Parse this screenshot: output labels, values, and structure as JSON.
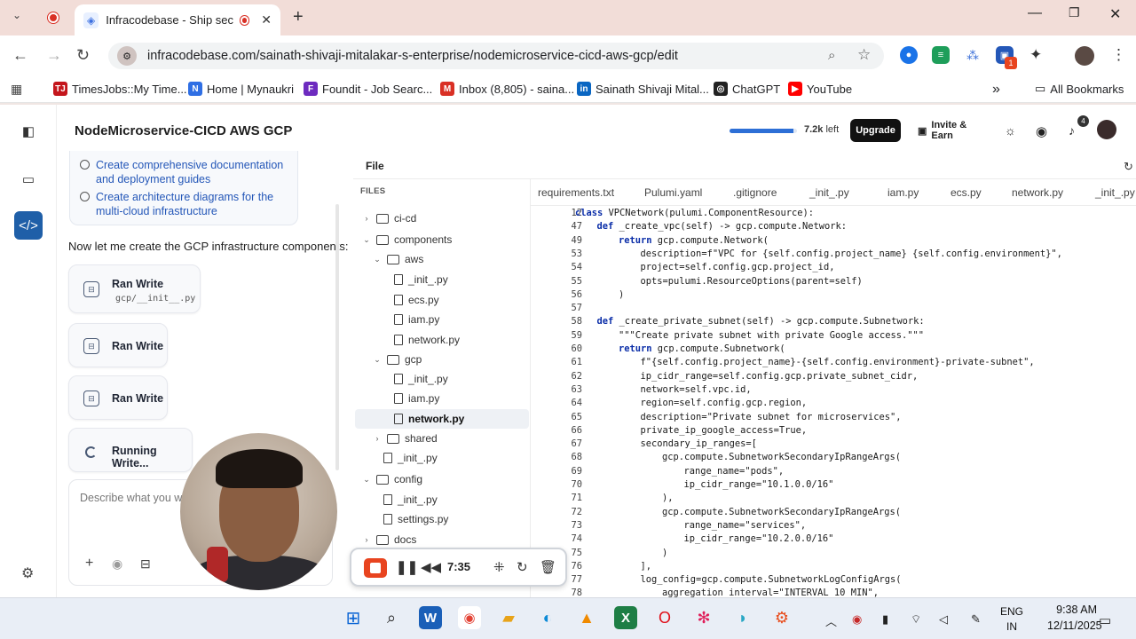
{
  "browser": {
    "tab_title": "Infracodebase - Ship secure",
    "url": "infracodebase.com/sainath-shivaji-mitalakar-s-enterprise/nodemicroservice-cicd-aws-gcp/edit",
    "extension_badge": "1",
    "bookmarks": [
      {
        "label": "TimesJobs::My Time...",
        "icon": "TJ",
        "color": "#c4161c"
      },
      {
        "label": "Home | Mynaukri",
        "icon": "N",
        "color": "#2f6fe4"
      },
      {
        "label": "Foundit - Job Searc...",
        "icon": "F",
        "color": "#6d2bbf"
      },
      {
        "label": "Inbox (8,805) - saina...",
        "icon": "M",
        "color": "#d93025"
      },
      {
        "label": "Sainath Shivaji Mital...",
        "icon": "in",
        "color": "#0a66c2"
      },
      {
        "label": "ChatGPT",
        "icon": "◎",
        "color": "#222222"
      },
      {
        "label": "YouTube",
        "icon": "▶",
        "color": "#ff0000"
      }
    ],
    "all_bookmarks": "All Bookmarks"
  },
  "app": {
    "title": "NodeMicroservice-CICD AWS GCP",
    "credits": "7.2k",
    "credits_suffix": "left",
    "credits_fraction": 0.95,
    "upgrade": "Upgrade",
    "invite": "Invite & Earn",
    "notif_count": "4"
  },
  "chat": {
    "todos": [
      "Create comprehensive documentation and deployment guides",
      "Create architecture diagrams for the multi-cloud infrastructure"
    ],
    "message": "Now let me create the GCP infrastructure components:",
    "tools": [
      {
        "label": "Ran Write",
        "sub": "gcp/__init__.py"
      },
      {
        "label": "Ran Write",
        "sub": ""
      },
      {
        "label": "Ran Write",
        "sub": ""
      },
      {
        "label": "Running Write...",
        "sub": ""
      }
    ],
    "placeholder": "Describe what you want"
  },
  "files": {
    "menu": "File",
    "header": "FILES",
    "tree": [
      {
        "label": "ci-cd",
        "type": "folder",
        "open": false,
        "depth": 0
      },
      {
        "label": "components",
        "type": "folder",
        "open": true,
        "depth": 0
      },
      {
        "label": "aws",
        "type": "folder",
        "open": true,
        "depth": 1
      },
      {
        "label": "_init_.py",
        "type": "file",
        "depth": 2
      },
      {
        "label": "ecs.py",
        "type": "file",
        "depth": 2
      },
      {
        "label": "iam.py",
        "type": "file",
        "depth": 2
      },
      {
        "label": "network.py",
        "type": "file",
        "depth": 2
      },
      {
        "label": "gcp",
        "type": "folder",
        "open": true,
        "depth": 1
      },
      {
        "label": "_init_.py",
        "type": "file",
        "depth": 2
      },
      {
        "label": "iam.py",
        "type": "file",
        "depth": 2
      },
      {
        "label": "network.py",
        "type": "file",
        "depth": 2,
        "selected": true
      },
      {
        "label": "shared",
        "type": "folder",
        "open": false,
        "depth": 1
      },
      {
        "label": "_init_.py",
        "type": "file",
        "depth": 1
      },
      {
        "label": "config",
        "type": "folder",
        "open": true,
        "depth": 0
      },
      {
        "label": "_init_.py",
        "type": "file",
        "depth": 1
      },
      {
        "label": "settings.py",
        "type": "file",
        "depth": 1
      },
      {
        "label": "docs",
        "type": "folder",
        "open": false,
        "depth": 0
      }
    ]
  },
  "editor": {
    "tabs": [
      "requirements.txt",
      "Pulumi.yaml",
      ".gitignore",
      "_init_.py",
      "iam.py",
      "ecs.py",
      "network.py",
      "_init_.py"
    ],
    "lines": [
      {
        "n": "12",
        "indent": 0,
        "text": "class VPCNetwork(pulumi.ComponentResource):"
      },
      {
        "n": "47",
        "indent": 1,
        "text": "def _create_vpc(self) -> gcp.compute.Network:"
      },
      {
        "n": "49",
        "indent": 2,
        "text": "return gcp.compute.Network("
      },
      {
        "n": "53",
        "indent": 3,
        "text": "description=f\"VPC for {self.config.project_name} {self.config.environment}\","
      },
      {
        "n": "54",
        "indent": 3,
        "text": "project=self.config.gcp.project_id,"
      },
      {
        "n": "55",
        "indent": 3,
        "text": "opts=pulumi.ResourceOptions(parent=self)"
      },
      {
        "n": "56",
        "indent": 2,
        "text": ")"
      },
      {
        "n": "57",
        "indent": 0,
        "text": ""
      },
      {
        "n": "58",
        "indent": 1,
        "text": "def _create_private_subnet(self) -> gcp.compute.Subnetwork:"
      },
      {
        "n": "59",
        "indent": 2,
        "text": "\"\"\"Create private subnet with private Google access.\"\"\""
      },
      {
        "n": "60",
        "indent": 2,
        "text": "return gcp.compute.Subnetwork("
      },
      {
        "n": "61",
        "indent": 3,
        "text": "f\"{self.config.project_name}-{self.config.environment}-private-subnet\","
      },
      {
        "n": "62",
        "indent": 3,
        "text": "ip_cidr_range=self.config.gcp.private_subnet_cidr,"
      },
      {
        "n": "63",
        "indent": 3,
        "text": "network=self.vpc.id,"
      },
      {
        "n": "64",
        "indent": 3,
        "text": "region=self.config.gcp.region,"
      },
      {
        "n": "65",
        "indent": 3,
        "text": "description=\"Private subnet for microservices\","
      },
      {
        "n": "66",
        "indent": 3,
        "text": "private_ip_google_access=True,"
      },
      {
        "n": "67",
        "indent": 3,
        "text": "secondary_ip_ranges=["
      },
      {
        "n": "68",
        "indent": 4,
        "text": "gcp.compute.SubnetworkSecondaryIpRangeArgs("
      },
      {
        "n": "69",
        "indent": 5,
        "text": "range_name=\"pods\","
      },
      {
        "n": "70",
        "indent": 5,
        "text": "ip_cidr_range=\"10.1.0.0/16\""
      },
      {
        "n": "71",
        "indent": 4,
        "text": "),"
      },
      {
        "n": "72",
        "indent": 4,
        "text": "gcp.compute.SubnetworkSecondaryIpRangeArgs("
      },
      {
        "n": "73",
        "indent": 5,
        "text": "range_name=\"services\","
      },
      {
        "n": "74",
        "indent": 5,
        "text": "ip_cidr_range=\"10.2.0.0/16\""
      },
      {
        "n": "75",
        "indent": 4,
        "text": ")"
      },
      {
        "n": "76",
        "indent": 3,
        "text": "],"
      },
      {
        "n": "77",
        "indent": 3,
        "text": "log_config=gcp.compute.SubnetworkLogConfigArgs("
      },
      {
        "n": "78",
        "indent": 4,
        "text": "aggregation_interval=\"INTERVAL_10_MIN\","
      }
    ]
  },
  "recorder": {
    "time": "7:35"
  },
  "taskbar": {
    "lang": "ENG",
    "region": "IN",
    "time": "9:38 AM",
    "date": "12/11/2025"
  }
}
